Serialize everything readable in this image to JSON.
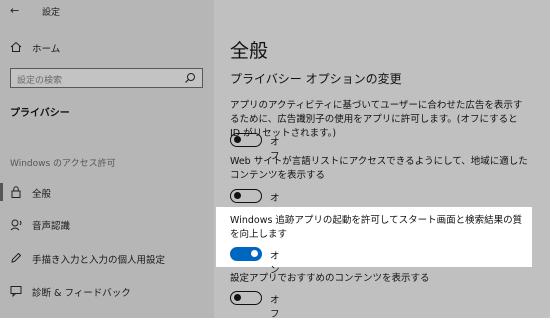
{
  "window": {
    "title": "設定",
    "back_icon": "arrow-left"
  },
  "sidebar": {
    "home_label": "ホーム",
    "search_placeholder": "設定の検索",
    "category": "プライバシー",
    "section_heading": "Windows のアクセス許可",
    "items": [
      {
        "label": "全般",
        "icon": "lock-icon",
        "selected": true
      },
      {
        "label": "音声認識",
        "icon": "speech-icon",
        "selected": false
      },
      {
        "label": "手描き入力と入力の個人用設定",
        "icon": "pen-icon",
        "selected": false
      },
      {
        "label": "診断 & フィードバック",
        "icon": "feedback-icon",
        "selected": false
      }
    ]
  },
  "main": {
    "title": "全般",
    "subtitle": "プライバシー オプションの変更",
    "settings": [
      {
        "desc": "アプリのアクティビティに基づいてユーザーに合わせた広告を表示するために、広告識別子の使用をアプリに許可します。(オフにすると ID がリセットされます。)",
        "state": "オフ",
        "on": false
      },
      {
        "desc": "Web サイトが言語リストにアクセスできるようにして、地域に適したコンテンツを表示する",
        "state": "オフ",
        "on": false
      },
      {
        "desc": "Windows 追跡アプリの起動を許可してスタート画面と検索結果の質を向上します",
        "state": "オン",
        "on": true
      },
      {
        "desc": "設定アプリでおすすめのコンテンツを表示する",
        "state": "オフ",
        "on": false
      }
    ]
  },
  "colors": {
    "toggle_on": "#0067c0",
    "dim_overlay": "#b6b6b6",
    "highlight": "#ffffff"
  }
}
